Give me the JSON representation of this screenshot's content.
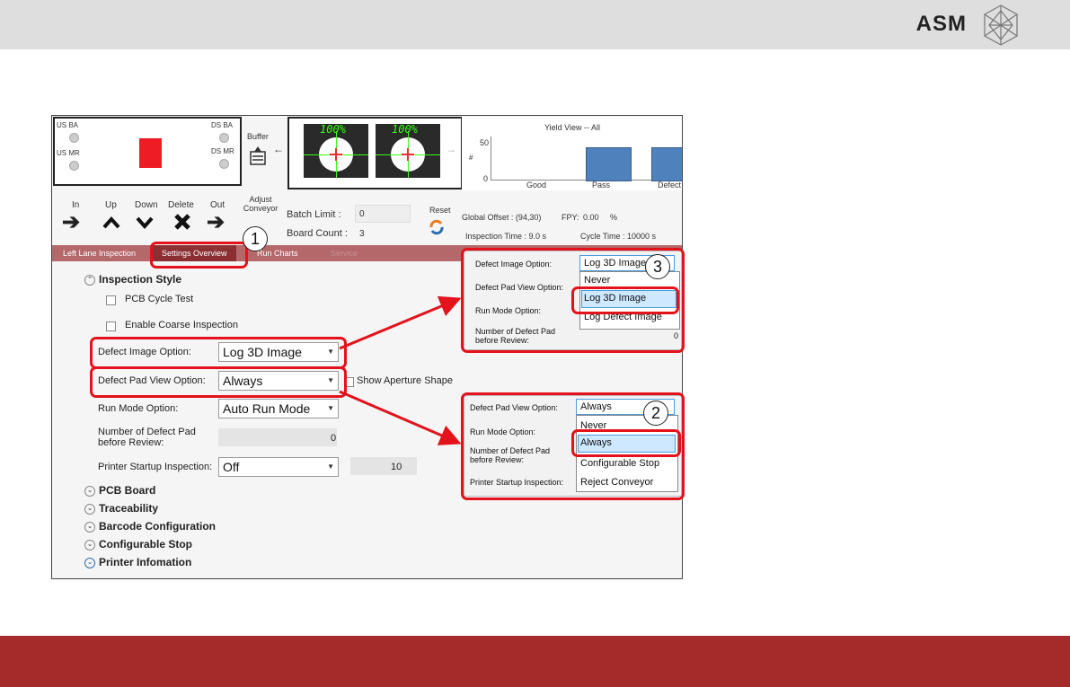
{
  "header": {
    "brand": "ASM"
  },
  "conveyor": {
    "us_ba": "US BA",
    "us_mr": "US MR",
    "ds_ba": "DS BA",
    "ds_mr": "DS MR",
    "buffer": "Buffer"
  },
  "cameras": [
    {
      "pct": "100%"
    },
    {
      "pct": "100%"
    }
  ],
  "yield": {
    "title": "Yield View -- All",
    "ytick_top": "50",
    "ytick_bottom": "0",
    "ylabel": "#",
    "chart_data": {
      "type": "bar",
      "title": "Yield View -- All",
      "categories": [
        "Good",
        "Pass",
        "Defect"
      ],
      "values": [
        0,
        45,
        45
      ],
      "ylim": [
        0,
        60
      ],
      "yticks": [
        0,
        50
      ],
      "ylabel": "#"
    }
  },
  "toolbar": {
    "in": "In",
    "up": "Up",
    "down": "Down",
    "delete": "Delete",
    "out": "Out",
    "adjust_conveyor": "Adjust Conveyor",
    "batch_limit_label": "Batch Limit :",
    "batch_limit_value": "0",
    "board_count_label": "Board Count :",
    "board_count_value": "3",
    "reset": "Reset",
    "global_offset": "Global Offset : (94,30)",
    "fpy_label": "FPY:",
    "fpy_value": "0.00",
    "fpy_unit": "%",
    "inspection_time": "Inspection Time : 9.0 s",
    "cycle_time": "Cycle Time : 10000 s"
  },
  "tabs": [
    "Left Lane Inspection",
    "Settings Overview",
    "Run Charts",
    "Service"
  ],
  "settings": {
    "inspection_style": "Inspection Style",
    "pcb_cycle_test": "PCB Cycle Test",
    "enable_coarse": "Enable Coarse Inspection",
    "defect_image_label": "Defect Image Option:",
    "defect_image_value": "Log 3D Image",
    "defect_pad_label": "Defect Pad View Option:",
    "defect_pad_value": "Always",
    "show_aperture": "Show Aperture Shape",
    "run_mode_label": "Run Mode Option:",
    "run_mode_value": "Auto Run Mode",
    "num_defect_label": "Number of Defect Pad before Review:",
    "num_defect_value": "0",
    "printer_startup_label": "Printer Startup Inspection:",
    "printer_startup_value": "Off",
    "printer_startup_num": "10"
  },
  "sections": [
    "PCB Board",
    "Traceability",
    "Barcode Configuration",
    "Configurable Stop",
    "Printer Infomation"
  ],
  "popup3": {
    "defect_image_label": "Defect Image Option:",
    "defect_image_value": "Log 3D Image",
    "defect_pad_label": "Defect Pad View Option:",
    "run_mode_label": "Run Mode Option:",
    "num_defect_label": "Number of Defect Pad before Review:",
    "num_value": "0",
    "options": [
      "Never",
      "Log 3D Image",
      "Log Defect Image"
    ]
  },
  "popup2": {
    "defect_pad_label": "Defect Pad View Option:",
    "defect_pad_value": "Always",
    "run_mode_label": "Run Mode Option:",
    "num_defect_label": "Number of Defect Pad before Review:",
    "printer_startup_label": "Printer Startup Inspection:",
    "options": [
      "Never",
      "Always",
      "Configurable Stop",
      "Reject Conveyor"
    ]
  },
  "callouts": [
    "1",
    "2",
    "3"
  ],
  "colors": {
    "accent_red": "#e3121b",
    "brand_bar": "#a52a2a",
    "tab_bar": "#b4686a",
    "bar_blue": "#4f81bd"
  }
}
